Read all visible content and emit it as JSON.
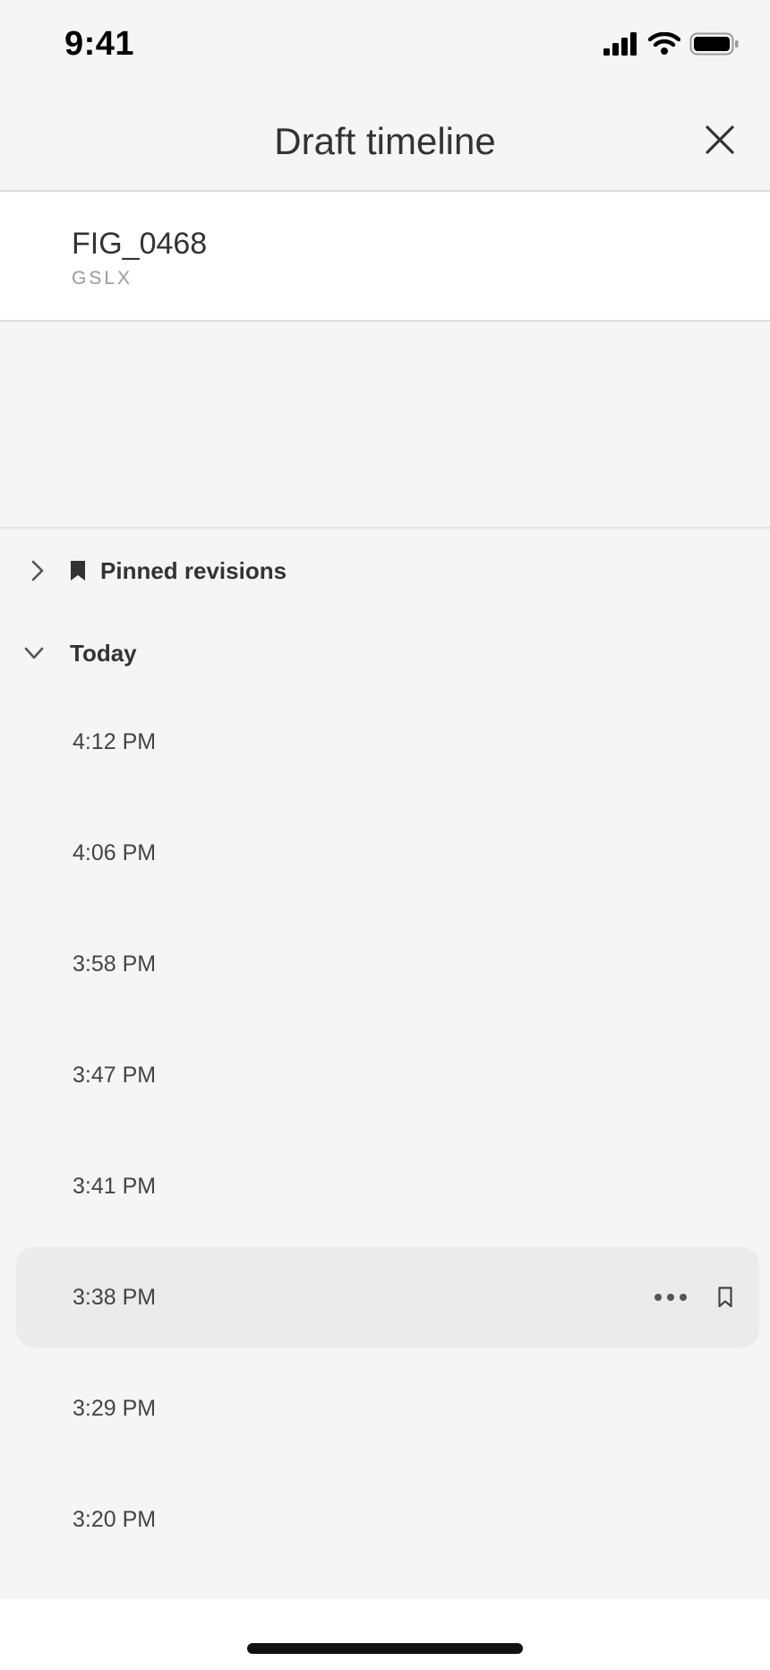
{
  "status_bar": {
    "time": "9:41",
    "icons": [
      "signal-icon",
      "wifi-icon",
      "battery-icon"
    ]
  },
  "header": {
    "title": "Draft timeline",
    "close_icon": "close-icon"
  },
  "file": {
    "name": "FIG_0468",
    "type": "GSLX"
  },
  "sections": {
    "pinned": {
      "label": "Pinned revisions",
      "expanded": false,
      "icon": "bookmark-icon"
    },
    "today": {
      "label": "Today",
      "expanded": true
    }
  },
  "revisions": [
    {
      "time": "4:12 PM"
    },
    {
      "time": "4:06 PM"
    },
    {
      "time": "3:58 PM"
    },
    {
      "time": "3:47 PM"
    },
    {
      "time": "3:41 PM"
    },
    {
      "time": "3:38 PM",
      "selected": true
    },
    {
      "time": "3:29 PM"
    },
    {
      "time": "3:20 PM"
    }
  ],
  "colors": {
    "background": "#f5f5f5",
    "card": "#ffffff",
    "selected_row": "#ebebeb",
    "text": "#333333",
    "muted": "#9a9a9a"
  }
}
